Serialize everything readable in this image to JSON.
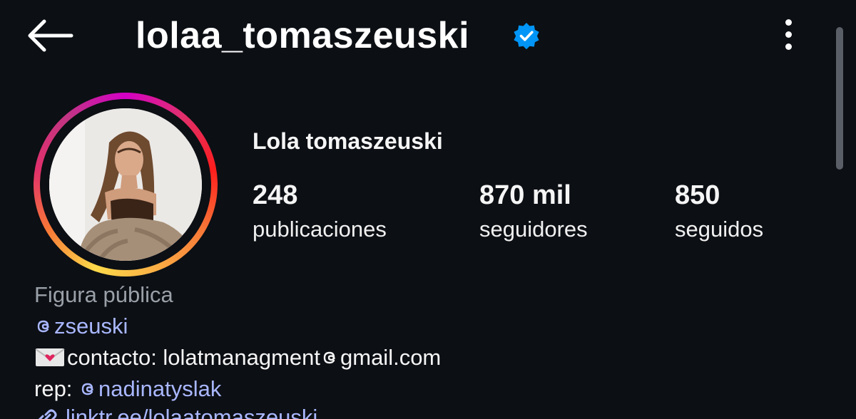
{
  "header": {
    "username": "lolaa_tomaszeuski",
    "back_icon": "arrow-left-icon",
    "verified_icon": "verified-badge-icon",
    "more_icon": "more-vertical-icon"
  },
  "profile": {
    "display_name": "Lola tomaszeuski",
    "stats": [
      {
        "value": "248",
        "label": "publicaciones"
      },
      {
        "value": "870 mil",
        "label": "seguidores"
      },
      {
        "value": "850",
        "label": "seguidos"
      }
    ],
    "bio": {
      "category": "Figura pública",
      "threads_handle": "zseuski",
      "contact_prefix": "contacto: lolatmanagment",
      "contact_suffix": "gmail.com",
      "rep_prefix": "rep: ",
      "rep_handle": "nadinatyslak",
      "link_text": "linktr.ee/lolaatomaszeuski"
    }
  },
  "colors": {
    "background": "#0c0f14",
    "link": "#a9b7ff",
    "verified": "#0095f6",
    "muted": "#9aa0a8"
  }
}
